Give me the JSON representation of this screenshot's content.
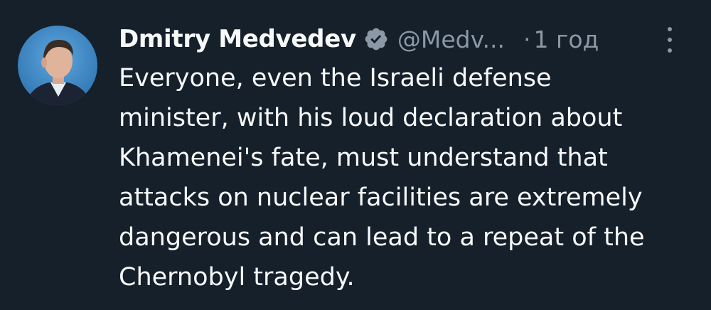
{
  "tweet": {
    "author": {
      "display_name": "Dmitry Medvedev",
      "verified": true,
      "handle": "@Medv...",
      "avatar_icon": "profile-photo"
    },
    "separator": "·",
    "timestamp": "1 год",
    "more_icon": "more-vertical-icon",
    "text_lines": [
      "Everyone, even the Israeli defense",
      "minister, with his loud declaration about",
      "Khamenei's fate, must understand that",
      "attacks on nuclear facilities are extremely",
      "dangerous and can lead to a repeat of the",
      "Chernobyl tragedy."
    ]
  },
  "colors": {
    "background": "#15202b",
    "primary_text": "#f7f9f9",
    "secondary_text": "#8b98a5",
    "verified_badge": "#8b98a5"
  }
}
